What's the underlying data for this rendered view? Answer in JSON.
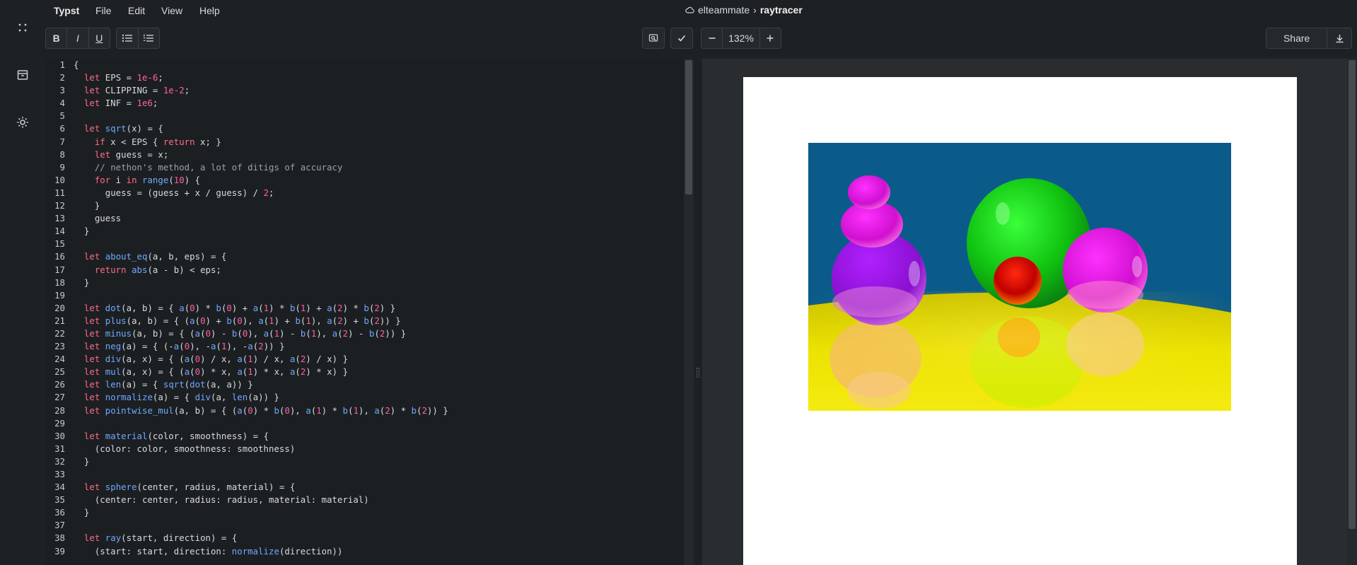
{
  "rail": {
    "icons": [
      "apps-icon",
      "archive-icon",
      "gear-icon"
    ]
  },
  "menubar": {
    "brand": "Typst",
    "menus": [
      "File",
      "Edit",
      "View",
      "Help"
    ]
  },
  "breadcrumb": {
    "owner": "elteammate",
    "separator": "›",
    "project": "raytracer"
  },
  "toolbar": {
    "bold": "B",
    "italic": "I",
    "underline": "U",
    "zoom": "132%",
    "share": "Share"
  },
  "editor": {
    "lines": [
      [
        [
          "p",
          "{"
        ]
      ],
      [
        [
          "k",
          "  let"
        ],
        [
          "p",
          " EPS = "
        ],
        [
          "n",
          "1e-6"
        ],
        [
          "p",
          ";"
        ]
      ],
      [
        [
          "k",
          "  let"
        ],
        [
          "p",
          " CLIPPING = "
        ],
        [
          "n",
          "1e-2"
        ],
        [
          "p",
          ";"
        ]
      ],
      [
        [
          "k",
          "  let"
        ],
        [
          "p",
          " INF = "
        ],
        [
          "n",
          "1e6"
        ],
        [
          "p",
          ";"
        ]
      ],
      [],
      [
        [
          "k",
          "  let"
        ],
        [
          "p",
          " "
        ],
        [
          "f",
          "sqrt"
        ],
        [
          "p",
          "(x) = {"
        ]
      ],
      [
        [
          "k",
          "    if"
        ],
        [
          "p",
          " x < EPS { "
        ],
        [
          "k",
          "return"
        ],
        [
          "p",
          " x; }"
        ]
      ],
      [
        [
          "k",
          "    let"
        ],
        [
          "p",
          " guess = x;"
        ]
      ],
      [
        [
          "c",
          "    // nethon's method, a lot of ditigs of accuracy"
        ]
      ],
      [
        [
          "k",
          "    for"
        ],
        [
          "p",
          " i "
        ],
        [
          "k",
          "in"
        ],
        [
          "p",
          " "
        ],
        [
          "f",
          "range"
        ],
        [
          "p",
          "("
        ],
        [
          "n",
          "10"
        ],
        [
          "p",
          ") {"
        ]
      ],
      [
        [
          "p",
          "      guess = (guess + x / guess) / "
        ],
        [
          "n",
          "2"
        ],
        [
          "p",
          ";"
        ]
      ],
      [
        [
          "p",
          "    }"
        ]
      ],
      [
        [
          "p",
          "    guess"
        ]
      ],
      [
        [
          "p",
          "  }"
        ]
      ],
      [],
      [
        [
          "k",
          "  let"
        ],
        [
          "p",
          " "
        ],
        [
          "f",
          "about_eq"
        ],
        [
          "p",
          "(a, b, eps) = {"
        ]
      ],
      [
        [
          "k",
          "    return"
        ],
        [
          "p",
          " "
        ],
        [
          "f",
          "abs"
        ],
        [
          "p",
          "(a - b) < eps;"
        ]
      ],
      [
        [
          "p",
          "  }"
        ]
      ],
      [],
      [
        [
          "k",
          "  let"
        ],
        [
          "p",
          " "
        ],
        [
          "f",
          "dot"
        ],
        [
          "p",
          "(a, b) = { "
        ],
        [
          "f",
          "a"
        ],
        [
          "p",
          "("
        ],
        [
          "n",
          "0"
        ],
        [
          "p",
          ") * "
        ],
        [
          "f",
          "b"
        ],
        [
          "p",
          "("
        ],
        [
          "n",
          "0"
        ],
        [
          "p",
          ") + "
        ],
        [
          "f",
          "a"
        ],
        [
          "p",
          "("
        ],
        [
          "n",
          "1"
        ],
        [
          "p",
          ") * "
        ],
        [
          "f",
          "b"
        ],
        [
          "p",
          "("
        ],
        [
          "n",
          "1"
        ],
        [
          "p",
          ") + "
        ],
        [
          "f",
          "a"
        ],
        [
          "p",
          "("
        ],
        [
          "n",
          "2"
        ],
        [
          "p",
          ") * "
        ],
        [
          "f",
          "b"
        ],
        [
          "p",
          "("
        ],
        [
          "n",
          "2"
        ],
        [
          "p",
          ") }"
        ]
      ],
      [
        [
          "k",
          "  let"
        ],
        [
          "p",
          " "
        ],
        [
          "f",
          "plus"
        ],
        [
          "p",
          "(a, b) = { ("
        ],
        [
          "f",
          "a"
        ],
        [
          "p",
          "("
        ],
        [
          "n",
          "0"
        ],
        [
          "p",
          ") + "
        ],
        [
          "f",
          "b"
        ],
        [
          "p",
          "("
        ],
        [
          "n",
          "0"
        ],
        [
          "p",
          "), "
        ],
        [
          "f",
          "a"
        ],
        [
          "p",
          "("
        ],
        [
          "n",
          "1"
        ],
        [
          "p",
          ") + "
        ],
        [
          "f",
          "b"
        ],
        [
          "p",
          "("
        ],
        [
          "n",
          "1"
        ],
        [
          "p",
          "), "
        ],
        [
          "f",
          "a"
        ],
        [
          "p",
          "("
        ],
        [
          "n",
          "2"
        ],
        [
          "p",
          ") + "
        ],
        [
          "f",
          "b"
        ],
        [
          "p",
          "("
        ],
        [
          "n",
          "2"
        ],
        [
          "p",
          ")) }"
        ]
      ],
      [
        [
          "k",
          "  let"
        ],
        [
          "p",
          " "
        ],
        [
          "f",
          "minus"
        ],
        [
          "p",
          "(a, b) = { ("
        ],
        [
          "f",
          "a"
        ],
        [
          "p",
          "("
        ],
        [
          "n",
          "0"
        ],
        [
          "p",
          ") - "
        ],
        [
          "f",
          "b"
        ],
        [
          "p",
          "("
        ],
        [
          "n",
          "0"
        ],
        [
          "p",
          "), "
        ],
        [
          "f",
          "a"
        ],
        [
          "p",
          "("
        ],
        [
          "n",
          "1"
        ],
        [
          "p",
          ") - "
        ],
        [
          "f",
          "b"
        ],
        [
          "p",
          "("
        ],
        [
          "n",
          "1"
        ],
        [
          "p",
          "), "
        ],
        [
          "f",
          "a"
        ],
        [
          "p",
          "("
        ],
        [
          "n",
          "2"
        ],
        [
          "p",
          ") - "
        ],
        [
          "f",
          "b"
        ],
        [
          "p",
          "("
        ],
        [
          "n",
          "2"
        ],
        [
          "p",
          ")) }"
        ]
      ],
      [
        [
          "k",
          "  let"
        ],
        [
          "p",
          " "
        ],
        [
          "f",
          "neg"
        ],
        [
          "p",
          "(a) = { (-"
        ],
        [
          "f",
          "a"
        ],
        [
          "p",
          "("
        ],
        [
          "n",
          "0"
        ],
        [
          "p",
          "), -"
        ],
        [
          "f",
          "a"
        ],
        [
          "p",
          "("
        ],
        [
          "n",
          "1"
        ],
        [
          "p",
          "), -"
        ],
        [
          "f",
          "a"
        ],
        [
          "p",
          "("
        ],
        [
          "n",
          "2"
        ],
        [
          "p",
          ")) }"
        ]
      ],
      [
        [
          "k",
          "  let"
        ],
        [
          "p",
          " "
        ],
        [
          "f",
          "div"
        ],
        [
          "p",
          "(a, x) = { ("
        ],
        [
          "f",
          "a"
        ],
        [
          "p",
          "("
        ],
        [
          "n",
          "0"
        ],
        [
          "p",
          ") / x, "
        ],
        [
          "f",
          "a"
        ],
        [
          "p",
          "("
        ],
        [
          "n",
          "1"
        ],
        [
          "p",
          ") / x, "
        ],
        [
          "f",
          "a"
        ],
        [
          "p",
          "("
        ],
        [
          "n",
          "2"
        ],
        [
          "p",
          ") / x) }"
        ]
      ],
      [
        [
          "k",
          "  let"
        ],
        [
          "p",
          " "
        ],
        [
          "f",
          "mul"
        ],
        [
          "p",
          "(a, x) = { ("
        ],
        [
          "f",
          "a"
        ],
        [
          "p",
          "("
        ],
        [
          "n",
          "0"
        ],
        [
          "p",
          ") * x, "
        ],
        [
          "f",
          "a"
        ],
        [
          "p",
          "("
        ],
        [
          "n",
          "1"
        ],
        [
          "p",
          ") * x, "
        ],
        [
          "f",
          "a"
        ],
        [
          "p",
          "("
        ],
        [
          "n",
          "2"
        ],
        [
          "p",
          ") * x) }"
        ]
      ],
      [
        [
          "k",
          "  let"
        ],
        [
          "p",
          " "
        ],
        [
          "f",
          "len"
        ],
        [
          "p",
          "(a) = { "
        ],
        [
          "f",
          "sqrt"
        ],
        [
          "p",
          "("
        ],
        [
          "f",
          "dot"
        ],
        [
          "p",
          "(a, a)) }"
        ]
      ],
      [
        [
          "k",
          "  let"
        ],
        [
          "p",
          " "
        ],
        [
          "f",
          "normalize"
        ],
        [
          "p",
          "(a) = { "
        ],
        [
          "f",
          "div"
        ],
        [
          "p",
          "(a, "
        ],
        [
          "f",
          "len"
        ],
        [
          "p",
          "(a)) }"
        ]
      ],
      [
        [
          "k",
          "  let"
        ],
        [
          "p",
          " "
        ],
        [
          "f",
          "pointwise_mul"
        ],
        [
          "p",
          "(a, b) = { ("
        ],
        [
          "f",
          "a"
        ],
        [
          "p",
          "("
        ],
        [
          "n",
          "0"
        ],
        [
          "p",
          ") * "
        ],
        [
          "f",
          "b"
        ],
        [
          "p",
          "("
        ],
        [
          "n",
          "0"
        ],
        [
          "p",
          "), "
        ],
        [
          "f",
          "a"
        ],
        [
          "p",
          "("
        ],
        [
          "n",
          "1"
        ],
        [
          "p",
          ") * "
        ],
        [
          "f",
          "b"
        ],
        [
          "p",
          "("
        ],
        [
          "n",
          "1"
        ],
        [
          "p",
          "), "
        ],
        [
          "f",
          "a"
        ],
        [
          "p",
          "("
        ],
        [
          "n",
          "2"
        ],
        [
          "p",
          ") * "
        ],
        [
          "f",
          "b"
        ],
        [
          "p",
          "("
        ],
        [
          "n",
          "2"
        ],
        [
          "p",
          ")) }"
        ]
      ],
      [],
      [
        [
          "k",
          "  let"
        ],
        [
          "p",
          " "
        ],
        [
          "f",
          "material"
        ],
        [
          "p",
          "(color, smoothness) = {"
        ]
      ],
      [
        [
          "p",
          "    (color: color, smoothness: smoothness)"
        ]
      ],
      [
        [
          "p",
          "  }"
        ]
      ],
      [],
      [
        [
          "k",
          "  let"
        ],
        [
          "p",
          " "
        ],
        [
          "f",
          "sphere"
        ],
        [
          "p",
          "(center, radius, material) = {"
        ]
      ],
      [
        [
          "p",
          "    (center: center, radius: radius, material: material)"
        ]
      ],
      [
        [
          "p",
          "  }"
        ]
      ],
      [],
      [
        [
          "k",
          "  let"
        ],
        [
          "p",
          " "
        ],
        [
          "f",
          "ray"
        ],
        [
          "p",
          "(start, direction) = {"
        ]
      ],
      [
        [
          "p",
          "    (start: start, direction: "
        ],
        [
          "f",
          "normalize"
        ],
        [
          "p",
          "(direction))"
        ]
      ]
    ]
  },
  "colors": {
    "keyword": "#ff6b88",
    "function": "#6fa8ff",
    "number": "#ff5fa6",
    "comment": "#9ba0a6",
    "sky": "#0b5b8a",
    "floor": "#f2e600"
  }
}
